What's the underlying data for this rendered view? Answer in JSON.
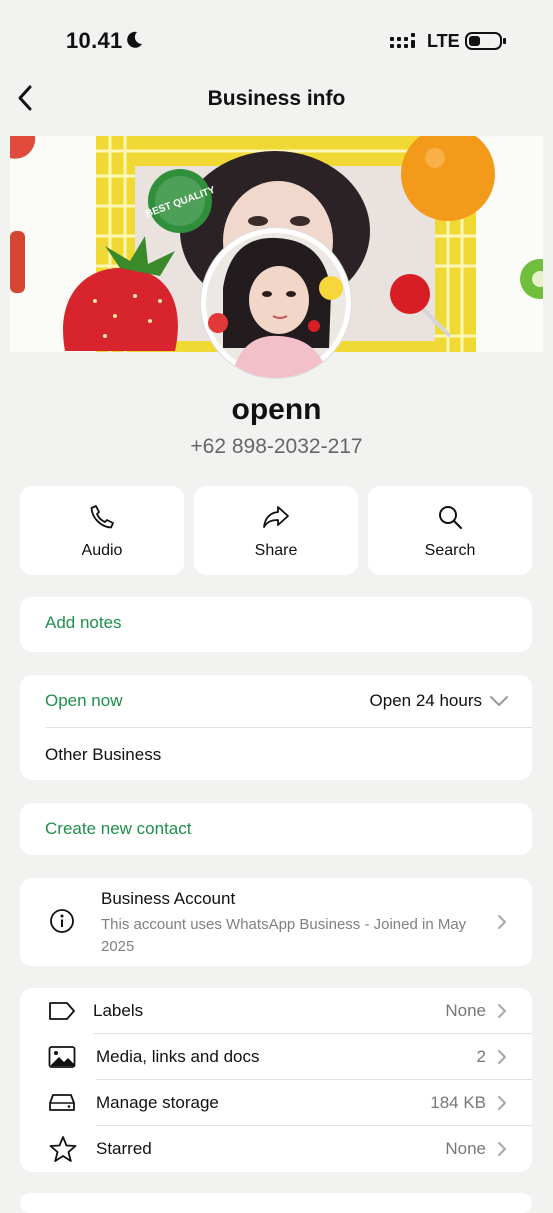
{
  "status": {
    "time": "10.41",
    "network": "LTE"
  },
  "nav": {
    "title": "Business info"
  },
  "profile": {
    "name": "openn",
    "phone": "+62 898-2032-217",
    "cover_badge": "BEST QUALITY"
  },
  "actions": [
    {
      "label": "Audio",
      "icon": "phone-icon"
    },
    {
      "label": "Share",
      "icon": "share-arrow-icon"
    },
    {
      "label": "Search",
      "icon": "search-icon"
    }
  ],
  "notes": {
    "label": "Add notes"
  },
  "hours": {
    "status": "Open now",
    "value": "Open 24 hours",
    "category": "Other Business"
  },
  "contact": {
    "label": "Create new contact"
  },
  "business_account": {
    "title": "Business Account",
    "description": "This account uses WhatsApp Business - Joined in May 2025"
  },
  "settings": [
    {
      "label": "Labels",
      "value": "None",
      "icon": "label-tag-icon"
    },
    {
      "label": "Media, links and docs",
      "value": "2",
      "icon": "image-icon"
    },
    {
      "label": "Manage storage",
      "value": "184 KB",
      "icon": "storage-drive-icon"
    },
    {
      "label": "Starred",
      "value": "None",
      "icon": "star-icon"
    }
  ],
  "colors": {
    "accent": "#1f8f4e",
    "background": "#f2f2f1"
  }
}
